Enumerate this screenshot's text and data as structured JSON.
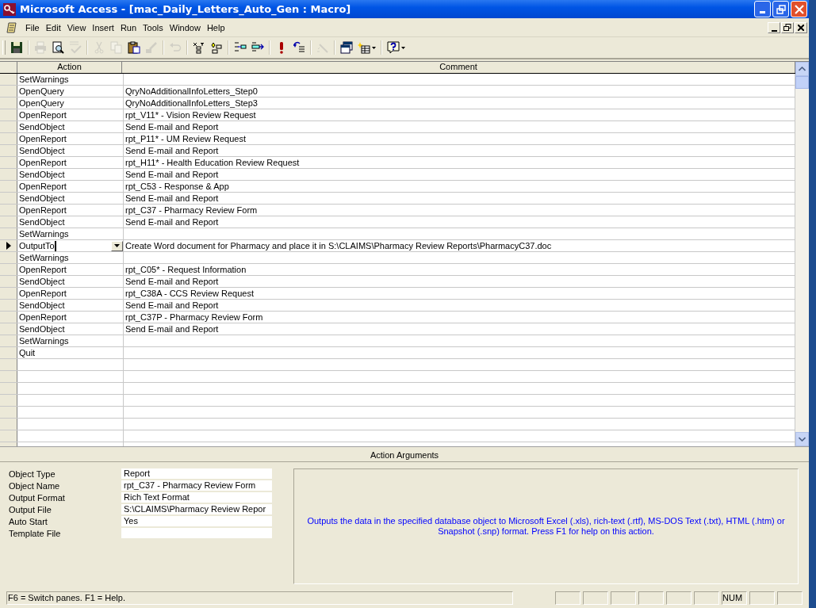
{
  "window": {
    "title": "Microsoft Access - [mac_Daily_Letters_Auto_Gen : Macro]"
  },
  "menu": [
    "File",
    "Edit",
    "View",
    "Insert",
    "Run",
    "Tools",
    "Window",
    "Help"
  ],
  "toolbar": [
    [
      {
        "kind": "save",
        "disabled": false
      }
    ],
    [
      {
        "kind": "print",
        "disabled": true
      },
      {
        "kind": "preview",
        "disabled": false
      },
      {
        "kind": "spelling",
        "disabled": true
      }
    ],
    [
      {
        "kind": "cut",
        "disabled": true
      },
      {
        "kind": "copy",
        "disabled": true
      },
      {
        "kind": "paste",
        "disabled": false
      },
      {
        "kind": "painter",
        "disabled": true
      }
    ],
    [
      {
        "kind": "undo",
        "disabled": true
      }
    ],
    [
      {
        "kind": "names",
        "disabled": false
      },
      {
        "kind": "conditions",
        "disabled": false
      }
    ],
    [
      {
        "kind": "insertrows",
        "disabled": false
      },
      {
        "kind": "deleterows",
        "disabled": false
      }
    ],
    [
      {
        "kind": "run",
        "disabled": false
      },
      {
        "kind": "step",
        "disabled": false
      }
    ],
    [
      {
        "kind": "builder",
        "disabled": true
      }
    ],
    [
      {
        "kind": "database",
        "disabled": false
      },
      {
        "kind": "newobject",
        "disabled": false
      }
    ],
    [
      {
        "kind": "help",
        "disabled": false
      }
    ]
  ],
  "table": {
    "columns": [
      "Action",
      "Comment"
    ],
    "rows": [
      {
        "action": "SetWarnings",
        "selected": false
      },
      {
        "action": "OpenQuery",
        "comment": "QryNoAdditionalInfoLetters_Step0",
        "selected": false
      },
      {
        "action": "OpenQuery",
        "comment": "QryNoAdditionalInfoLetters_Step3",
        "selected": false
      },
      {
        "action": "OpenReport",
        "comment": "rpt_V11* - Vision Review Request",
        "selected": false
      },
      {
        "action": "SendObject",
        "comment": "Send E-mail and Report",
        "selected": false
      },
      {
        "action": "OpenReport",
        "comment": "rpt_P11* - UM Review Request",
        "selected": false
      },
      {
        "action": "SendObject",
        "comment": "Send E-mail and Report",
        "selected": false
      },
      {
        "action": "OpenReport",
        "comment": "rpt_H11* - Health Education Review Request",
        "selected": false
      },
      {
        "action": "SendObject",
        "comment": "Send E-mail and Report",
        "selected": false
      },
      {
        "action": "OpenReport",
        "comment": "rpt_C53 - Response & App",
        "selected": false
      },
      {
        "action": "SendObject",
        "comment": "Send E-mail and Report",
        "selected": false
      },
      {
        "action": "OpenReport",
        "comment": "rpt_C37 - Pharmacy Review Form",
        "selected": false
      },
      {
        "action": "SendObject",
        "comment": "Send E-mail and Report",
        "selected": false
      },
      {
        "action": "SetWarnings",
        "selected": false
      },
      {
        "action": "OutputTo",
        "comment": "Create Word document for Pharmacy and place it in S:\\CLAIMS\\Pharmacy Review Reports\\PharmacyC37.doc",
        "selected": true
      },
      {
        "action": "SetWarnings",
        "selected": false
      },
      {
        "action": "OpenReport",
        "comment": "rpt_C05* - Request Information",
        "selected": false
      },
      {
        "action": "SendObject",
        "comment": "Send E-mail and Report",
        "selected": false
      },
      {
        "action": "OpenReport",
        "comment": "rpt_C38A - CCS Review Request",
        "selected": false
      },
      {
        "action": "SendObject",
        "comment": "Send E-mail and Report",
        "selected": false
      },
      {
        "action": "OpenReport",
        "comment": "rpt_C37P - Pharmacy Review Form",
        "selected": false
      },
      {
        "action": "SendObject",
        "comment": "Send E-mail and Report",
        "selected": false
      },
      {
        "action": "SetWarnings",
        "selected": false
      },
      {
        "action": "Quit",
        "selected": false
      }
    ]
  },
  "action_arguments": {
    "title": "Action Arguments",
    "arguments": [
      {
        "label": "Object Type",
        "value": "Report"
      },
      {
        "label": "Object Name",
        "value": "rpt_C37 - Pharmacy Review Form"
      },
      {
        "label": "Output Format",
        "value": "Rich Text Format"
      },
      {
        "label": "Output File",
        "value": "S:\\CLAIMS\\Pharmacy Review Repor"
      },
      {
        "label": "Auto Start",
        "value": "Yes"
      },
      {
        "label": "Template File"
      }
    ],
    "description": "Outputs the data in the specified database object to Microsoft Excel (.xls), rich-text (.rtf), MS-DOS Text (.txt), HTML (.htm) or Snapshot (.snp) format. Press F1 for help on this action."
  },
  "status_bar": {
    "message": "F6 = Switch panes.  F1 = Help.",
    "indicators": [
      "NUM"
    ]
  }
}
